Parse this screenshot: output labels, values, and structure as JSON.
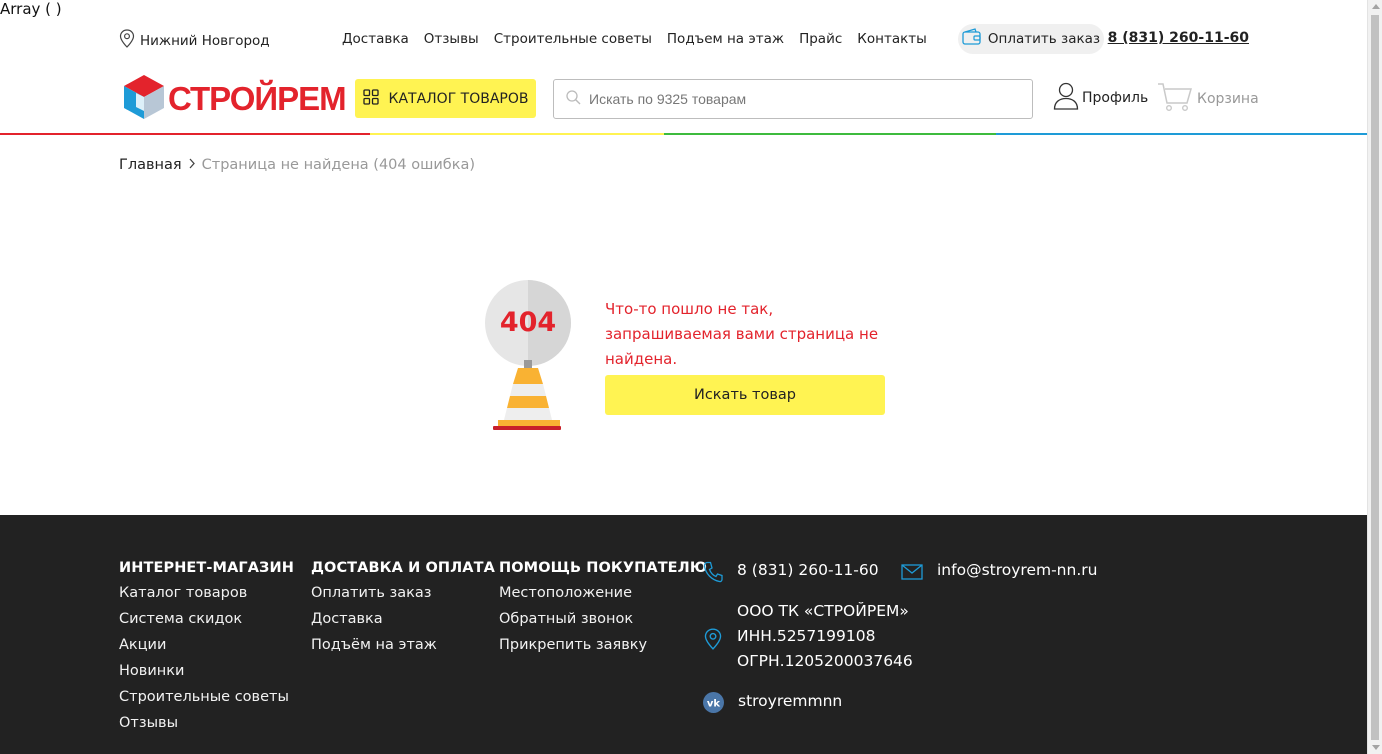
{
  "debug_text": "Array ( )",
  "topbar": {
    "city": "Нижний Новгород",
    "nav": [
      "Доставка",
      "Отзывы",
      "Строительные советы",
      "Подъем на этаж",
      "Прайс",
      "Контакты"
    ],
    "pay_label": "Оплатить заказ",
    "phone": "8 (831) 260-11-60"
  },
  "header": {
    "logo_text": "СТРОЙРЕМ",
    "catalog_label": "КАТАЛОГ ТОВАРОВ",
    "search_placeholder": "Искать по 9325 товарам",
    "profile_label": "Профиль",
    "cart_label": "Корзина"
  },
  "colors": {
    "accent_yellow": "#fff352",
    "brand_red": "#e3232c",
    "line": [
      "#e3232c",
      "#fff352",
      "#3dbb3d",
      "#1e9bd7"
    ]
  },
  "breadcrumb": {
    "home": "Главная",
    "current": "Страница не найдена (404 ошибка)"
  },
  "notfound": {
    "code": "404",
    "message": "Что-то пошло не так, запрашиваемая вами страница не найдена.",
    "button": "Искать товар"
  },
  "footer": {
    "col1": {
      "title": "ИНТЕРНЕТ-МАГАЗИН",
      "items": [
        "Каталог товаров",
        "Система скидок",
        "Акции",
        "Новинки",
        "Строительные советы",
        "Отзывы"
      ]
    },
    "col2": {
      "title": "ДОСТАВКА И ОПЛАТА",
      "items": [
        "Оплатить заказ",
        "Доставка",
        "Подъём на этаж"
      ]
    },
    "col3": {
      "title": "ПОМОЩЬ ПОКУПАТЕЛЮ",
      "items": [
        "Местоположение",
        "Обратный звонок",
        "Прикрепить заявку"
      ]
    },
    "phone": "8 (831) 260-11-60",
    "email": "info@stroyrem-nn.ru",
    "company": [
      "ООО ТК «СТРОЙРЕМ»",
      "ИНН.5257199108",
      "ОГРН.1205200037646"
    ],
    "vk": "stroyremmnn"
  }
}
